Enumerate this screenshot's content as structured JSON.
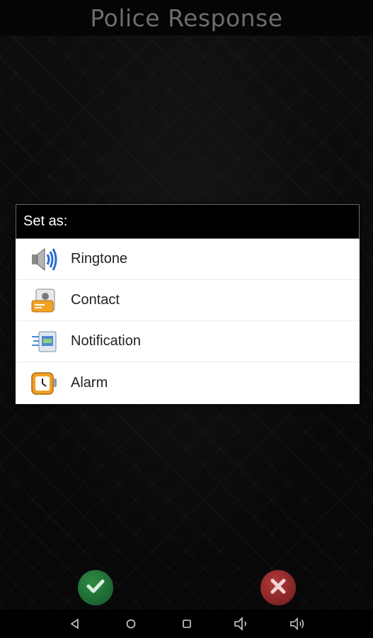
{
  "app": {
    "title": "Police Response"
  },
  "dialog": {
    "title": "Set as:",
    "options": [
      {
        "label": "Ringtone",
        "icon": "speaker-volume-icon"
      },
      {
        "label": "Contact",
        "icon": "contact-card-icon"
      },
      {
        "label": "Notification",
        "icon": "notification-icon"
      },
      {
        "label": "Alarm",
        "icon": "alarm-clock-icon"
      }
    ]
  },
  "actions": {
    "confirm_icon": "checkmark-icon",
    "cancel_icon": "x-icon",
    "confirm_color": "#1f6b34",
    "cancel_color": "#8a2222"
  },
  "navbar": {
    "buttons": [
      "back-icon",
      "home-icon",
      "recents-icon",
      "volume-down-icon",
      "volume-up-icon"
    ]
  }
}
